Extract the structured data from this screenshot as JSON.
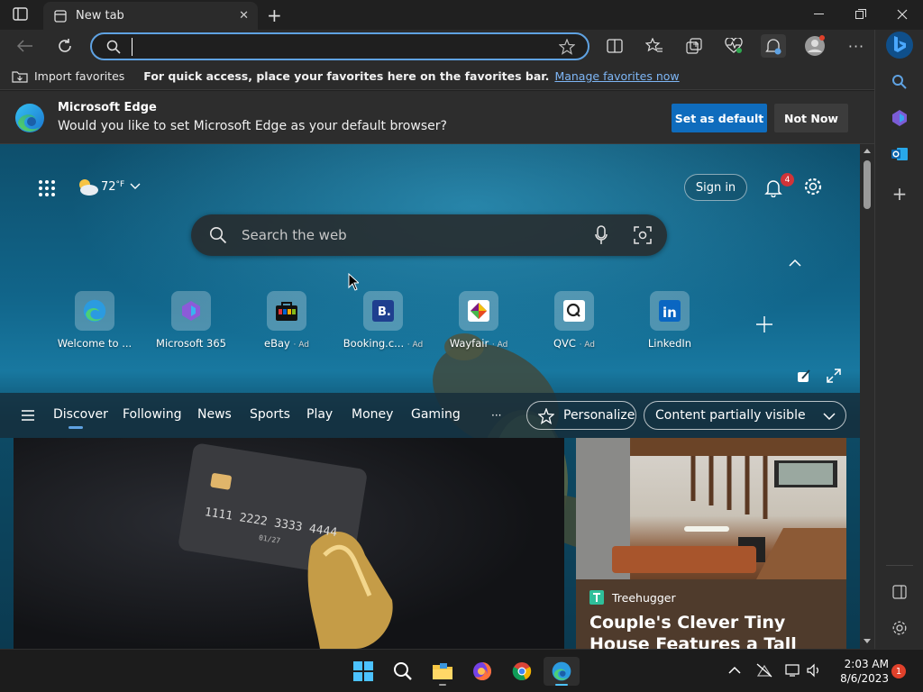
{
  "tab": {
    "title": "New tab"
  },
  "address_bar": {
    "value": "",
    "placeholder": ""
  },
  "favorites_bar": {
    "import_label": "Import favorites",
    "quick_access_text": "For quick access, place your favorites here on the favorites bar.",
    "manage_link": "Manage favorites now"
  },
  "infobar": {
    "heading": "Microsoft Edge",
    "message": "Would you like to set Microsoft Edge as your default browser?",
    "set_default_label": "Set as default",
    "not_now_label": "Not Now"
  },
  "weather": {
    "temp": "72",
    "unit": "°F"
  },
  "header": {
    "sign_in_label": "Sign in",
    "notification_count": "4"
  },
  "search": {
    "placeholder": "Search the web"
  },
  "quick_links": [
    {
      "label": "Welcome to ...",
      "ad": ""
    },
    {
      "label": "Microsoft 365",
      "ad": ""
    },
    {
      "label": "eBay",
      "ad": "· Ad"
    },
    {
      "label": "Booking.c...",
      "ad": "· Ad"
    },
    {
      "label": "Wayfair",
      "ad": "· Ad"
    },
    {
      "label": "QVC",
      "ad": "· Ad"
    },
    {
      "label": "LinkedIn",
      "ad": ""
    }
  ],
  "feed_nav": {
    "items": [
      "Discover",
      "Following",
      "News",
      "Sports",
      "Play",
      "Money",
      "Gaming"
    ],
    "more": "···",
    "personalize_label": "Personalize",
    "visibility_label": "Content partially visible"
  },
  "cards": {
    "card1": {
      "card_number": "1111 2222 3333 4444",
      "expiry": "01/27"
    },
    "card2": {
      "source": "Treehugger",
      "headline": "Couple's Clever Tiny House Features a Tall Shower and"
    }
  },
  "taskbar": {
    "time": "2:03 AM",
    "date": "8/6/2023",
    "notification_count": "1"
  },
  "colors": {
    "accent": "#0f6cbd",
    "link": "#7eb6f5",
    "badge": "#d13438"
  }
}
